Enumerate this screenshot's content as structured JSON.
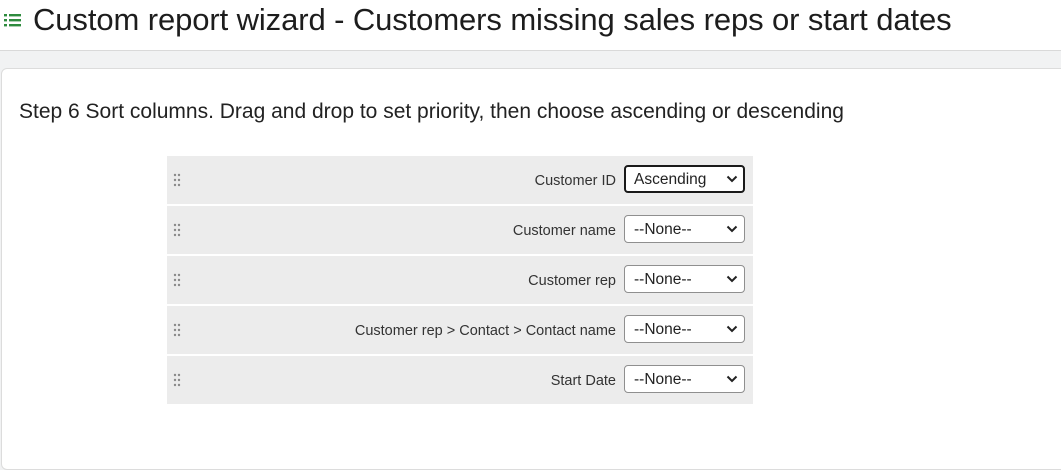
{
  "header": {
    "title": "Custom report wizard - Customers missing sales reps or start dates",
    "icon": "list-icon",
    "accent_color": "#2e8b3e"
  },
  "step": {
    "title": "Step 6 Sort columns. Drag and drop to set priority, then choose ascending or descending"
  },
  "sort_rows": [
    {
      "label": "Customer ID",
      "value": "Ascending",
      "focused": true
    },
    {
      "label": "Customer name",
      "value": "--None--",
      "focused": false
    },
    {
      "label": "Customer rep",
      "value": "--None--",
      "focused": false
    },
    {
      "label": "Customer rep > Contact > Contact name",
      "value": "--None--",
      "focused": false
    },
    {
      "label": "Start Date",
      "value": "--None--",
      "focused": false
    }
  ]
}
